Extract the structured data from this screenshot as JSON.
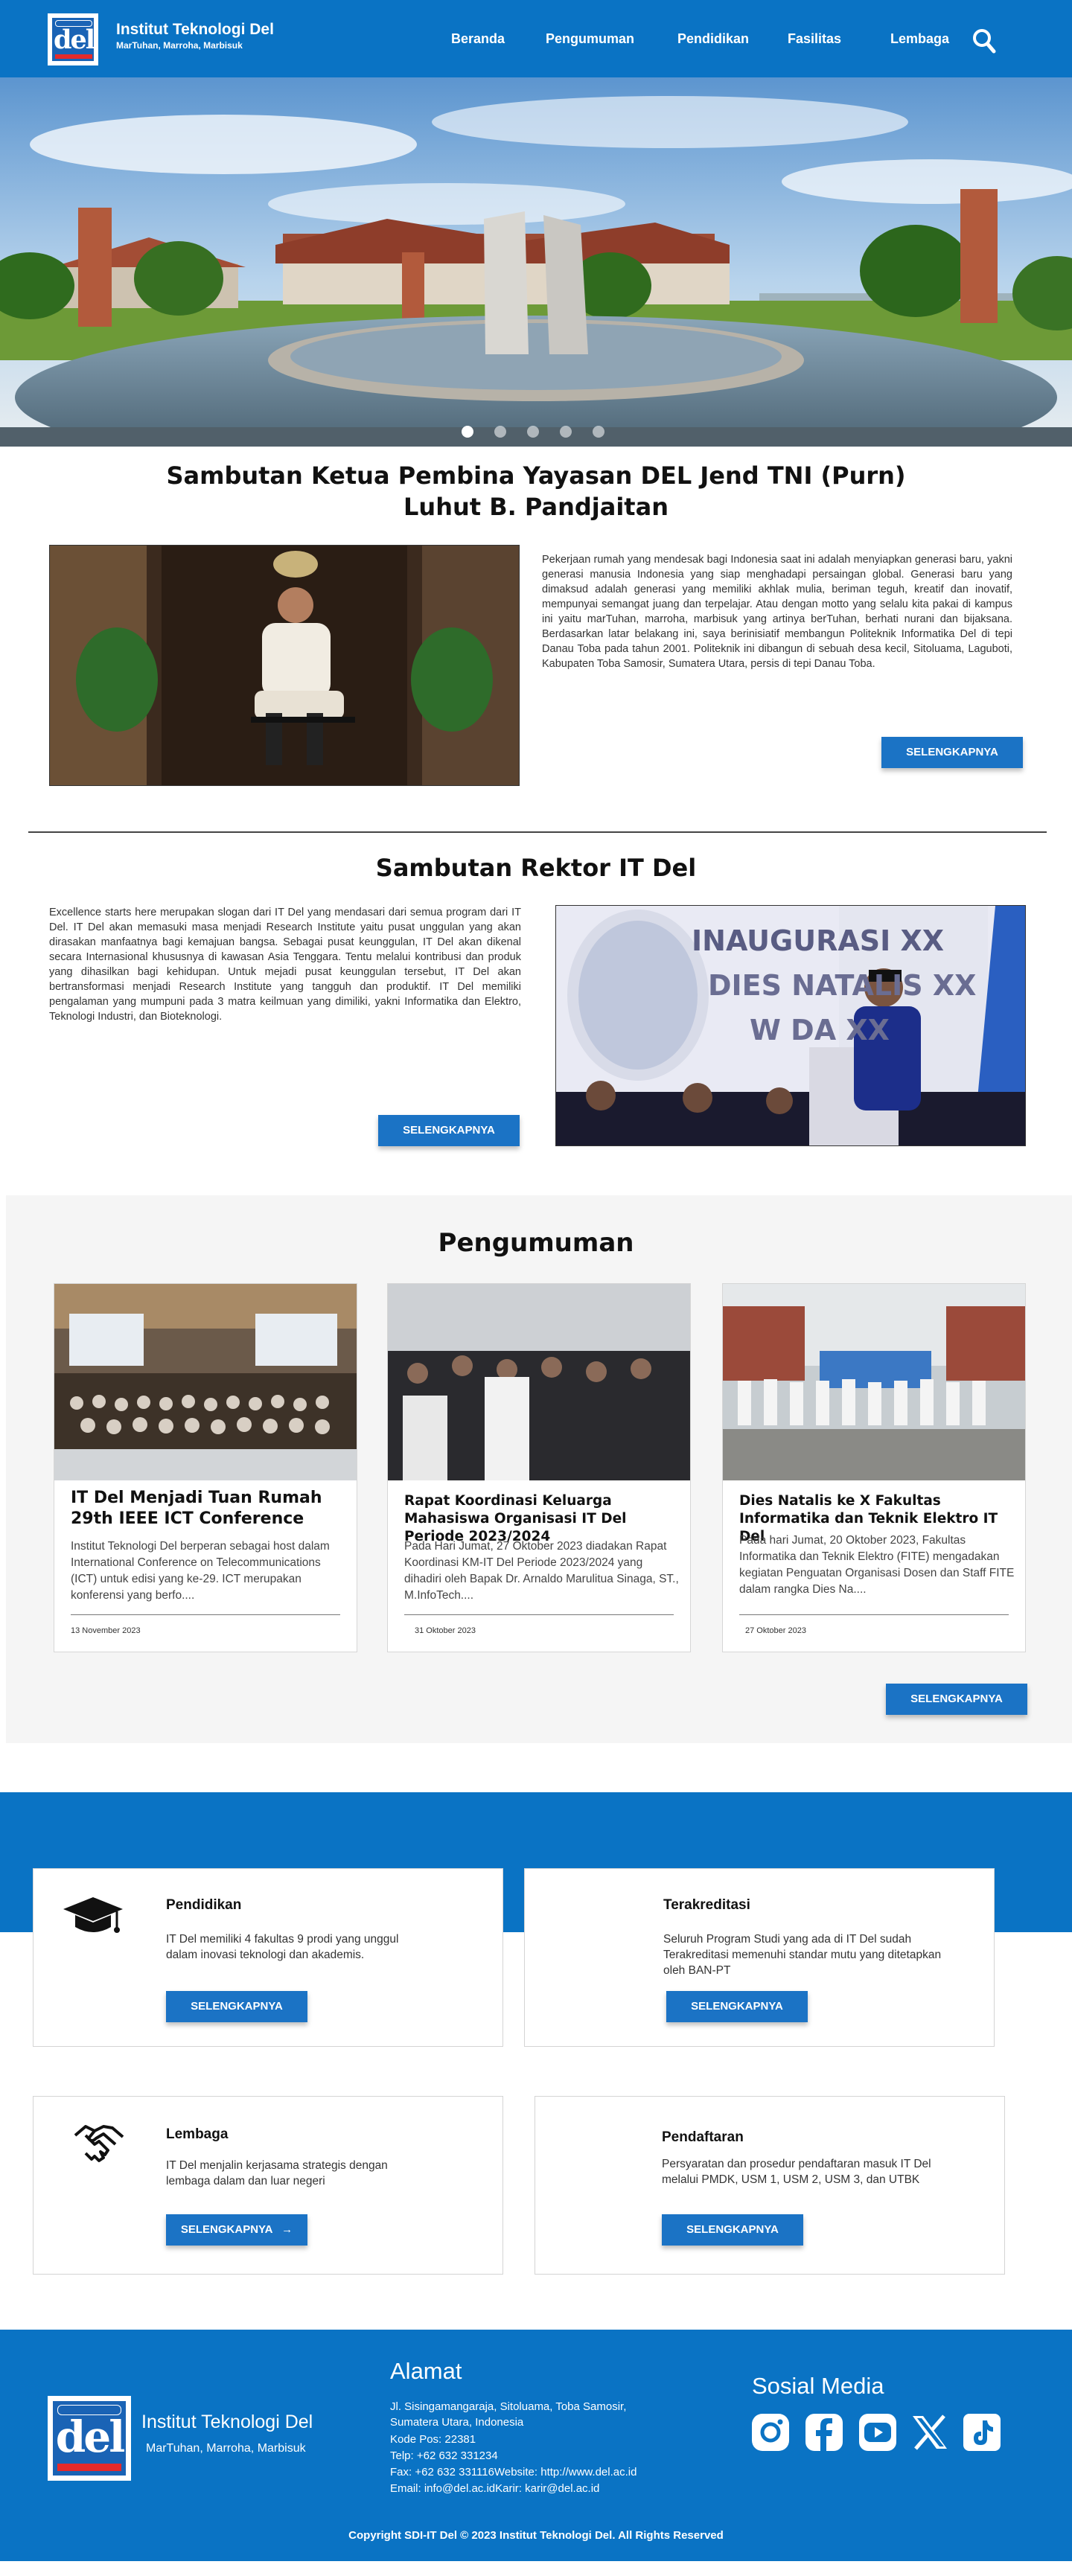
{
  "header": {
    "logo_text": "del",
    "title": "Institut Teknologi Del",
    "subtitle": "MarTuhan, Marroha, Marbisuk",
    "nav": [
      {
        "label": "Beranda"
      },
      {
        "label": "Pengumuman"
      },
      {
        "label": "Pendidikan"
      },
      {
        "label": "Fasilitas"
      },
      {
        "label": "Lembaga"
      }
    ],
    "search_icon": "search-icon"
  },
  "hero": {
    "slides_count": 5,
    "active_slide": 1
  },
  "ketua": {
    "title_line1": "Sambutan Ketua Pembina Yayasan DEL Jend TNI (Purn)",
    "title_line2": "Luhut B. Pandjaitan",
    "text": "Pekerjaan rumah yang mendesak bagi Indonesia saat ini adalah menyiapkan generasi baru, yakni generasi manusia Indonesia yang siap menghadapi persaingan global. Generasi baru yang dimaksud adalah generasi yang memiliki akhlak mulia, beriman teguh, kreatif dan inovatif, mempunyai semangat juang dan terpelajar. Atau dengan motto yang selalu kita pakai di kampus ini yaitu marTuhan, marroha, marbisuk yang artinya berTuhan, berhati nurani dan bijaksana. Berdasarkan latar belakang ini, saya berinisiatif membangun Politeknik Informatika Del di tepi Danau Toba pada tahun 2001. Politeknik ini dibangun di sebuah desa kecil, Sitoluama, Laguboti, Kabupaten Toba Samosir, Sumatera Utara, persis di tepi Danau Toba.",
    "button": "SELENGKAPNYA"
  },
  "rektor": {
    "title": "Sambutan Rektor IT Del",
    "text": "Excellence starts here merupakan slogan dari IT Del yang mendasari dari semua program dari IT Del. IT Del akan memasuki masa menjadi Research Institute yaitu pusat unggulan yang akan dirasakan manfaatnya bagi kemajuan bangsa. Sebagai pusat keunggulan, IT Del akan dikenal secara Internasional khususnya di kawasan Asia Tenggara. Tentu melalui kontribusi dan produk yang dihasilkan bagi kehidupan. Untuk mejadi pusat keunggulan tersebut, IT Del akan bertransformasi menjadi Research Institute yang tangguh dan produktif. IT Del memiliki pengalaman yang mumpuni pada 3 matra keilmuan yang dimiliki, yakni Informatika dan Elektro, Teknologi Industri, dan Bioteknologi.",
    "button": "SELENGKAPNYA",
    "banner_text_1": "INAUGURASI XX",
    "banner_text_2": "DIES NATALIS XX",
    "banner_text_3": "W DA XX"
  },
  "pengumuman": {
    "title": "Pengumuman",
    "cards": [
      {
        "title": "IT Del Menjadi Tuan Rumah 29th IEEE ICT Conference",
        "body": "Institut Teknologi Del berperan sebagai host dalam International Conference on Telecommunications (ICT) untuk edisi yang ke-29. ICT merupakan konferensi yang berfo....",
        "date": "13 November 2023"
      },
      {
        "title": "Rapat Koordinasi Keluarga Mahasiswa Organisasi IT Del Periode 2023/2024",
        "body": "Pada Hari Jumat, 27 Oktober 2023 diadakan Rapat Koordinasi KM-IT Del Periode 2023/2024 yang dihadiri oleh Bapak Dr. Arnaldo Marulitua Sinaga, ST., M.InfoTech....",
        "date": "31 Oktober 2023"
      },
      {
        "title": "Dies Natalis ke X Fakultas Informatika dan Teknik Elektro IT Del",
        "body": "Pada hari Jumat, 20 Oktober 2023, Fakultas Informatika dan Teknik Elektro (FITE) mengadakan kegiatan Penguatan Organisasi Dosen dan Staff FITE dalam rangka Dies Na....",
        "date": "27 Oktober 2023"
      }
    ],
    "button": "SELENGKAPNYA"
  },
  "features": [
    {
      "icon": "graduation-cap-icon",
      "title": "Pendidikan",
      "body": "IT Del memiliki 4 fakultas 9 prodi yang unggul dalam inovasi teknologi dan akademis.",
      "button": "SELENGKAPNYA"
    },
    {
      "icon": "",
      "title": "Terakreditasi",
      "body": "Seluruh Program Studi yang ada di IT Del sudah Terakreditasi memenuhi standar mutu yang ditetapkan oleh BAN-PT",
      "button": "SELENGKAPNYA"
    },
    {
      "icon": "handshake-icon",
      "title": "Lembaga",
      "body": "IT Del menjalin kerjasama strategis dengan lembaga dalam dan luar negeri",
      "button": "SELENGKAPNYA",
      "button_arrow": "→"
    },
    {
      "icon": "",
      "title": "Pendaftaran",
      "body": "Persyaratan dan prosedur pendaftaran masuk IT Del melalui PMDK, USM 1, USM 2, USM 3, dan UTBK",
      "button": "SELENGKAPNYA"
    }
  ],
  "footer": {
    "brand": "Institut Teknologi Del",
    "motto": "MarTuhan, Marroha, Marbisuk",
    "alamat_title": "Alamat",
    "alamat_lines": [
      "Jl. Sisingamangaraja, Sitoluama, Toba Samosir,",
      "Sumatera Utara, Indonesia",
      "Kode Pos: 22381",
      "Telp: +62 632 331234",
      "Fax: +62 632 331116Website: http://www.del.ac.id",
      "Email: info@del.ac.idKarir: karir@del.ac.id"
    ],
    "sosial_title": "Sosial Media",
    "social_icons": [
      "instagram-icon",
      "facebook-icon",
      "youtube-icon",
      "x-icon",
      "tiktok-icon"
    ],
    "copyright": "Copyright SDI-IT Del © 2023 Institut Teknologi Del. All Rights Reserved"
  },
  "colors": {
    "primary": "#0a73c4",
    "button": "#1b73c5",
    "section_bg": "#f5f5f5"
  }
}
